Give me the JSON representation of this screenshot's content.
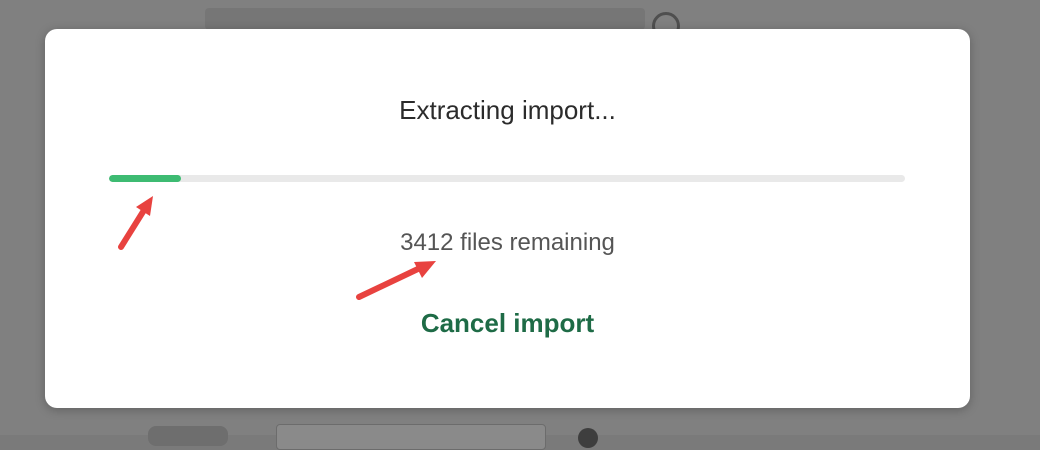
{
  "modal": {
    "title": "Extracting import...",
    "progress_fraction": 0.09,
    "progress_color": "#3dbb72",
    "files_remaining_count": "3412",
    "files_remaining_suffix": " files remaining",
    "cancel_label": "Cancel import",
    "cancel_color": "#1e6b46"
  },
  "annotations": {
    "arrow_color": "#e8423f"
  }
}
